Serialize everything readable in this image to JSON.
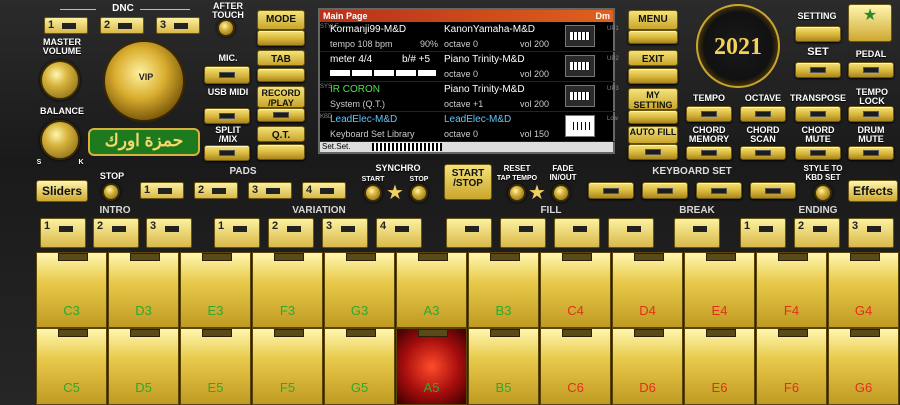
{
  "top": {
    "dnc": "DNC",
    "after_touch": "AFTER TOUCH",
    "master_volume": "MASTER VOLUME",
    "balance": "BALANCE",
    "balance_s": "S",
    "balance_k": "K",
    "logo_text": "VIP",
    "arabic_name": "حمزة اورك",
    "mic": "MIC.",
    "usb_midi": "USB MIDI",
    "split_mix": "SPLIT /MIX",
    "dnc_nums": [
      "1",
      "2",
      "3"
    ]
  },
  "modes": {
    "mode": "MODE",
    "tab": "TAB",
    "record_play": "RECORD /PLAY",
    "qt": "Q.T."
  },
  "screen": {
    "title": "Main Page",
    "key": "Dm",
    "footer": "Set.Set.",
    "rows": [
      {
        "left_name": "Kormanji99-M&D",
        "left_sub": "tempo 108 bpm",
        "left_val": "90%",
        "right_name": "KanonYamaha-M&D",
        "right_sub": "octave  0",
        "right_vol": "vol 200",
        "side": "UP1",
        "sideL": "STYLE"
      },
      {
        "left_name": "meter 4/4",
        "left_sub": "",
        "left_val": "b/# +5",
        "right_name": "Piano Trinity-M&D",
        "right_sub": "octave  0",
        "right_vol": "vol 200",
        "side": "UP2",
        "sideL": ""
      },
      {
        "left_name": "IR CORON",
        "left_sub": "System (Q.T.)",
        "left_val": "",
        "right_name": "Piano Trinity-M&D",
        "right_sub": "octave +1",
        "right_vol": "vol 200",
        "side": "UP3",
        "sideL": "SYS"
      },
      {
        "left_name": "LeadElec-M&D",
        "left_sub": "Keyboard Set Library",
        "left_val": "",
        "right_name": "LeadElec-M&D",
        "right_sub": "octave  0",
        "right_vol": "vol 150",
        "side": "Low",
        "sideL": "KBD"
      }
    ]
  },
  "right": {
    "menu": "MENU",
    "exit": "EXIT",
    "my_setting": "MY SETTING",
    "auto_fill": "AUTO FILL",
    "setting": "SETTING",
    "set": "SET",
    "pedal": "PEDAL",
    "year": "2021",
    "tempo": "TEMPO",
    "octave": "OCTAVE",
    "transpose": "TRANSPOSE",
    "tempo_lock": "TEMPO LOCK",
    "chord_memory": "CHORD MEMORY",
    "chord_scan": "CHORD SCAN",
    "chord_mute": "CHORD MUTE",
    "drum_mute": "DRUM MUTE"
  },
  "middle": {
    "sliders": "Sliders",
    "stop": "STOP",
    "pads": "PADS",
    "pad_nums": [
      "1",
      "2",
      "3",
      "4"
    ],
    "synchro": "SYNCHRO",
    "sync_start": "START",
    "sync_stop": "STOP",
    "start_stop": "START /STOP",
    "reset": "RESET",
    "tap_tempo": "TAP TEMPO",
    "fade": "FADE IN/OUT",
    "keyboard_set": "KEYBOARD SET",
    "style_to_kbd": "STYLE TO KBD SET",
    "effects": "Effects"
  },
  "sections": {
    "intro": "INTRO",
    "variation": "VARIATION",
    "fill": "FILL",
    "break": "BREAK",
    "ending": "ENDING",
    "intro_nums": [
      "1",
      "2",
      "3"
    ],
    "var_nums": [
      "1",
      "2",
      "3",
      "4"
    ],
    "end_nums": [
      "1",
      "2",
      "3"
    ]
  },
  "keys": {
    "row1": [
      "C3",
      "D3",
      "E3",
      "F3",
      "G3",
      "A3",
      "B3",
      "C4",
      "D4",
      "E4",
      "F4",
      "G4"
    ],
    "row2": [
      "C5",
      "D5",
      "E5",
      "F5",
      "G5",
      "A5",
      "B5",
      "C6",
      "D6",
      "E6",
      "F6",
      "G6"
    ],
    "colors": {
      "white_note": "#2ea82e",
      "red_note": "#e23018"
    }
  }
}
